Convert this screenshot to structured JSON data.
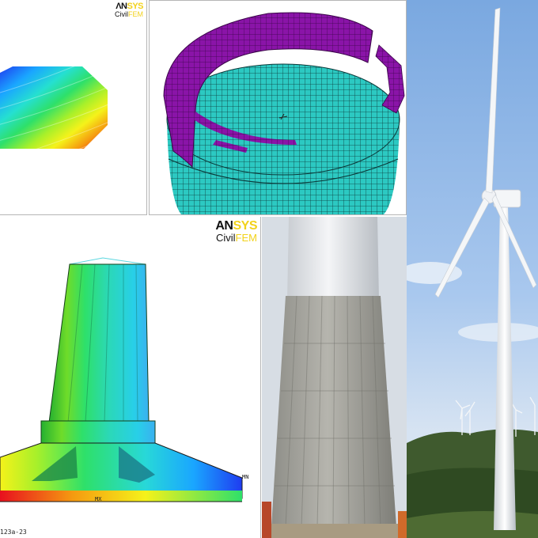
{
  "contour_panel": {
    "logo": {
      "brand_a": "ΛN",
      "brand_b": "SYS",
      "sub_a": "Civil",
      "sub_b": "FEM"
    }
  },
  "tower_panel": {
    "logo": {
      "brand_a": "AN",
      "brand_b": "SYS",
      "sub_a": "Civil",
      "sub_b": "FEM"
    },
    "label_max": "MX",
    "label_min": "MN",
    "plot_id": "123a-23"
  },
  "colors": {
    "contour_red": "#e8101e",
    "contour_blue": "#1f3cf0",
    "mesh_teal": "#29c8c0",
    "mesh_purple": "#8a14a8",
    "ansys_yellow": "#f2d21b",
    "sky": "#8fb8e6"
  }
}
